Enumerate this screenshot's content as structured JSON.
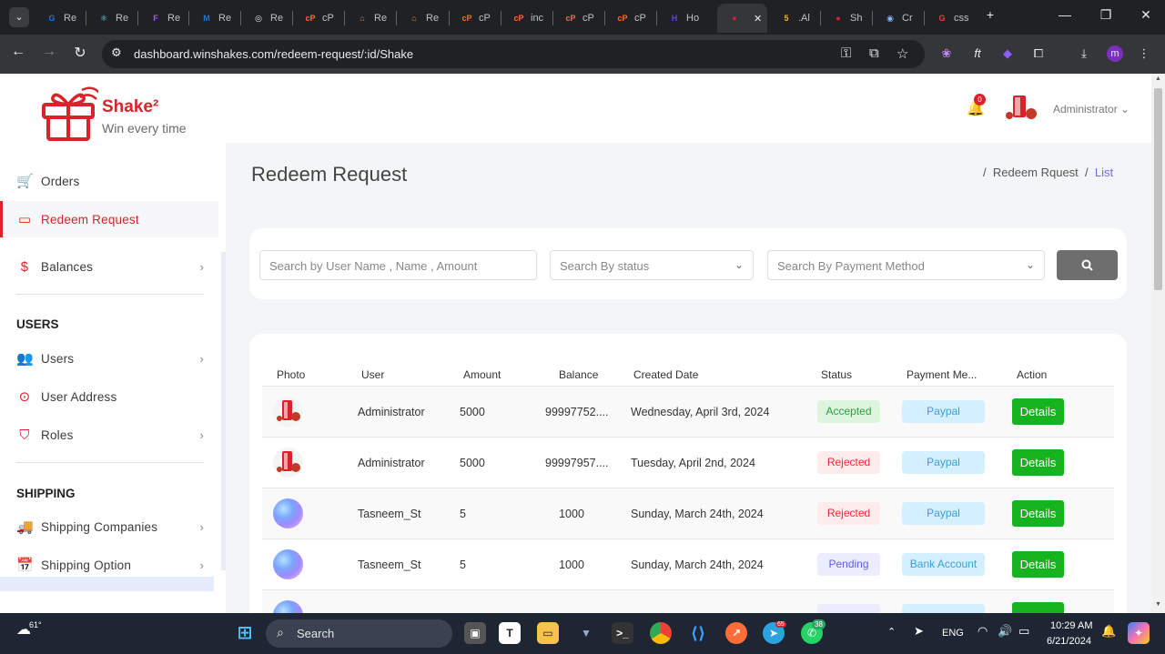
{
  "browser": {
    "tabs": [
      {
        "label": "Re",
        "icon": "G",
        "color": "#1a73e8"
      },
      {
        "label": "Re",
        "icon": "⚛",
        "color": "#61dafb"
      },
      {
        "label": "Re",
        "icon": "F",
        "color": "#a259ff"
      },
      {
        "label": "Re",
        "icon": "M",
        "color": "#1976d2"
      },
      {
        "label": "Re",
        "icon": "◎",
        "color": "#e8eaed"
      },
      {
        "label": "cP",
        "icon": "cP",
        "color": "#ff6c2c"
      },
      {
        "label": "Re",
        "icon": "⌂",
        "color": "#d18b47"
      },
      {
        "label": "Re",
        "icon": "⌂",
        "color": "#d18b47"
      },
      {
        "label": "cP",
        "icon": "cP",
        "color": "#ff6c2c"
      },
      {
        "label": "inc",
        "icon": "cP",
        "color": "#ff6c2c"
      },
      {
        "label": "cP",
        "icon": "cP",
        "color": "#ff6c2c"
      },
      {
        "label": "cP",
        "icon": "cP",
        "color": "#ff6c2c"
      },
      {
        "label": "Ho",
        "icon": "H",
        "color": "#673de6"
      },
      {
        "label": "",
        "icon": "●",
        "color": "#d8232a",
        "active": true
      },
      {
        "label": ".Al",
        "icon": "5",
        "color": "#f5b400"
      },
      {
        "label": "Sh",
        "icon": "●",
        "color": "#d8232a"
      },
      {
        "label": "Cr",
        "icon": "◉",
        "color": "#8ab4f8"
      },
      {
        "label": "css",
        "icon": "G",
        "color": "#ea4335"
      }
    ],
    "url": "dashboard.winshakes.com/redeem-request/:id/Shake",
    "profile_initial": "m"
  },
  "brand": {
    "name": "Shake²",
    "tagline": "Win every time",
    "color": "#d8232a"
  },
  "sidebar": {
    "items": [
      {
        "label": "Orders",
        "icon": "cart-icon",
        "glyph": "🛒"
      },
      {
        "label": "Redeem Request",
        "icon": "card-icon",
        "glyph": "▭",
        "active": true
      },
      {
        "label": "Balances",
        "icon": "dollar-icon",
        "glyph": "$",
        "chevron": true
      }
    ],
    "sections": [
      {
        "title": "USERS",
        "items": [
          {
            "label": "Users",
            "icon": "users-icon",
            "glyph": "👥",
            "chevron": true
          },
          {
            "label": "User Address",
            "icon": "location-pin-icon",
            "glyph": "⊙"
          },
          {
            "label": "Roles",
            "icon": "shield-icon",
            "glyph": "⛉",
            "chevron": true
          }
        ]
      },
      {
        "title": "SHIPPING",
        "items": [
          {
            "label": "Shipping Companies",
            "icon": "truck-icon",
            "glyph": "🚚",
            "chevron": true
          },
          {
            "label": "Shipping Option",
            "icon": "calendar-icon",
            "glyph": "📅",
            "chevron": true
          }
        ]
      }
    ]
  },
  "header": {
    "notification_count": "0",
    "user_name": "Administrator"
  },
  "page": {
    "title": "Redeem Request",
    "breadcrumb": [
      "Redeem Rquest",
      "List"
    ]
  },
  "filters": {
    "search_placeholder": "Search by User Name , Name , Amount",
    "status_placeholder": "Search By status",
    "payment_placeholder": "Search By Payment Method"
  },
  "table": {
    "columns": [
      "Photo",
      "User",
      "Amount",
      "Balance",
      "Created Date",
      "Status",
      "Payment Me...",
      "Action"
    ],
    "rows": [
      {
        "avatar": "admin",
        "user": "Administrator",
        "amount": "5000",
        "balance": "99997752....",
        "date": "Wednesday, April 3rd, 2024",
        "status": "Accepted",
        "payment": "Paypal",
        "action": "Details"
      },
      {
        "avatar": "admin",
        "user": "Administrator",
        "amount": "5000",
        "balance": "99997957....",
        "date": "Tuesday, April 2nd, 2024",
        "status": "Rejected",
        "payment": "Paypal",
        "action": "Details"
      },
      {
        "avatar": "user",
        "user": "Tasneem_St",
        "amount": "5",
        "balance": "1000",
        "date": "Sunday, March 24th, 2024",
        "status": "Rejected",
        "payment": "Paypal",
        "action": "Details"
      },
      {
        "avatar": "user",
        "user": "Tasneem_St",
        "amount": "5",
        "balance": "1000",
        "date": "Sunday, March 24th, 2024",
        "status": "Pending",
        "payment": "Bank Account",
        "action": "Details"
      }
    ]
  },
  "taskbar": {
    "weather": "61°",
    "search_label": "Search",
    "language": "ENG",
    "time": "10:29 AM",
    "date": "6/21/2024",
    "whatsapp_badge": "38",
    "telegram_badge": "65"
  }
}
